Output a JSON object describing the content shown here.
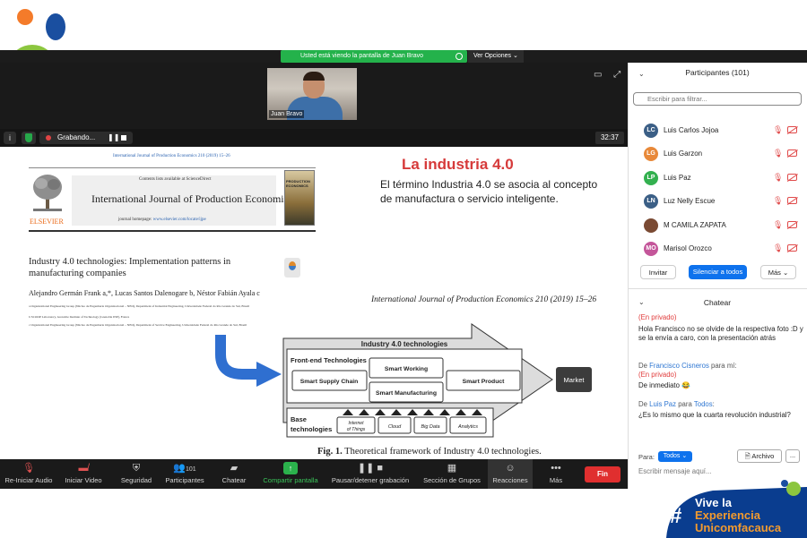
{
  "share_banner": {
    "text": "Usted está viendo la pantalla de Juan Bravo",
    "view_options": "Ver Opciones"
  },
  "video": {
    "speaker_name": "Juan Bravo"
  },
  "recording": {
    "label": "Grabando...",
    "timer": "32:37"
  },
  "slide": {
    "journal_cite": "International Journal of Production Economics 210 (2019) 15–26",
    "contents_line": "Contents lists available at ScienceDirect",
    "journal_title": "International Journal of Production Economics",
    "homepage_label": "journal homepage:",
    "homepage_url": "www.elsevier.com/locate/ijpe",
    "publisher": "ELSEVIER",
    "cover_text": "PRODUCTION ECONOMICS",
    "paper_title": "Industry 4.0 technologies: Implementation patterns in manufacturing companies",
    "authors": "Alejandro Germán Frank a,*, Lucas Santos Dalenogare b, Néstor Fabián Ayala c",
    "affiliations": [
      "a Organizational Engineering Group (Núcleo de Engenharia Organizacional – NEO), Department of Industrial Engineering, Universidade Federal do Rio Grande do Sul, Brazil",
      "b SCOOP Laboratory, Grenoble Institute of Technology (Grenoble INP), France",
      "c Organizational Engineering Group (Núcleo de Engenharia Organizacional – NEO), Department of Service Engineering, Universidade Federal do Rio Grande do Sul, Brazil"
    ],
    "heading": "La industria 4.0",
    "body": "El término Industria 4.0 se asocia al concepto de manufactura o servicio inteligente.",
    "citation": "International Journal of Production Economics 210 (2019) 15–26",
    "figure_caption_bold": "Fig. 1.",
    "figure_caption": "Theoretical framework of Industry 4.0 technologies.",
    "diagram": {
      "title": "Industry 4.0 technologies",
      "front_end": "Front-end Technologies",
      "smart_supply_chain": "Smart Supply Chain",
      "smart_working": "Smart Working",
      "smart_manufacturing": "Smart Manufacturing",
      "smart_product": "Smart Product",
      "market": "Market",
      "base": "Base technologies",
      "base_items": [
        "Internet of Things",
        "Cloud",
        "Big Data",
        "Analytics"
      ]
    }
  },
  "toolbar": {
    "items": [
      {
        "label": "Re-Iniciar Audio",
        "icon": "microphone-muted-icon"
      },
      {
        "label": "Iniciar Video",
        "icon": "video-off-icon"
      },
      {
        "label": "Seguridad",
        "icon": "shield-icon"
      },
      {
        "label": "Participantes",
        "icon": "participants-icon",
        "count": "101"
      },
      {
        "label": "Chatear",
        "icon": "chat-icon"
      },
      {
        "label": "Compartir pantalla",
        "icon": "share-screen-icon"
      },
      {
        "label": "Pausar/detener grabación",
        "icon": "pause-stop-icon"
      },
      {
        "label": "Sección de Grupos",
        "icon": "breakout-rooms-icon"
      },
      {
        "label": "Reacciones",
        "icon": "reactions-icon"
      },
      {
        "label": "Más",
        "icon": "more-icon"
      }
    ],
    "end": "Fin"
  },
  "participants": {
    "title": "Participantes (101)",
    "search_placeholder": "Escribir para filtrar...",
    "list": [
      {
        "initials": "LC",
        "name": "Luis Carlos Jojoa",
        "color": "#3b5f86"
      },
      {
        "initials": "LG",
        "name": "Luis Garzon",
        "color": "#e8893a"
      },
      {
        "initials": "LP",
        "name": "Luis Paz",
        "color": "#33b04f"
      },
      {
        "initials": "LN",
        "name": "Luz Nelly Escue",
        "color": "#3b5f86"
      },
      {
        "initials": "",
        "name": "M CAMILA ZAPATA",
        "color": "#7a4a33"
      },
      {
        "initials": "MO",
        "name": "Marisol Orozco",
        "color": "#c4569a"
      }
    ],
    "invite": "Invitar",
    "mute_all": "Silenciar a todos",
    "more": "Más"
  },
  "chat": {
    "title": "Chatear",
    "messages": [
      {
        "private": "(En privado)",
        "text": "Hola Francisco no se olvide de la respectiva foto :D y se la envía a caro, con la presentación atrás"
      },
      {
        "from_prefix": "De ",
        "from": "Francisco Cisneros",
        "to": " para mí:",
        "private": "(En privado)",
        "text": "De inmediato 😂"
      },
      {
        "from_prefix": "De ",
        "from": "Luis Paz",
        "to_prefix": " para ",
        "to": "Todos",
        "to_suffix": ":",
        "text": "¿Es lo mismo que la cuarta revolución industrial?"
      }
    ],
    "to_label": "Para:",
    "to_value": "Todos",
    "file_button": "Archivo",
    "more_button": "...",
    "input_placeholder": "Escribir mensaje aquí..."
  },
  "branding": {
    "line1": "Vive la",
    "line2": "Experiencia",
    "line3": "Unicomfacauca",
    "hash": "#"
  },
  "colors": {
    "zoom_dark": "#1a1a1a",
    "zoom_blue": "#0e72ed",
    "share_green": "#24b24b",
    "slide_red": "#d63a3a",
    "brand_blue": "#0a3d8f",
    "brand_orange": "#f29a2e"
  }
}
